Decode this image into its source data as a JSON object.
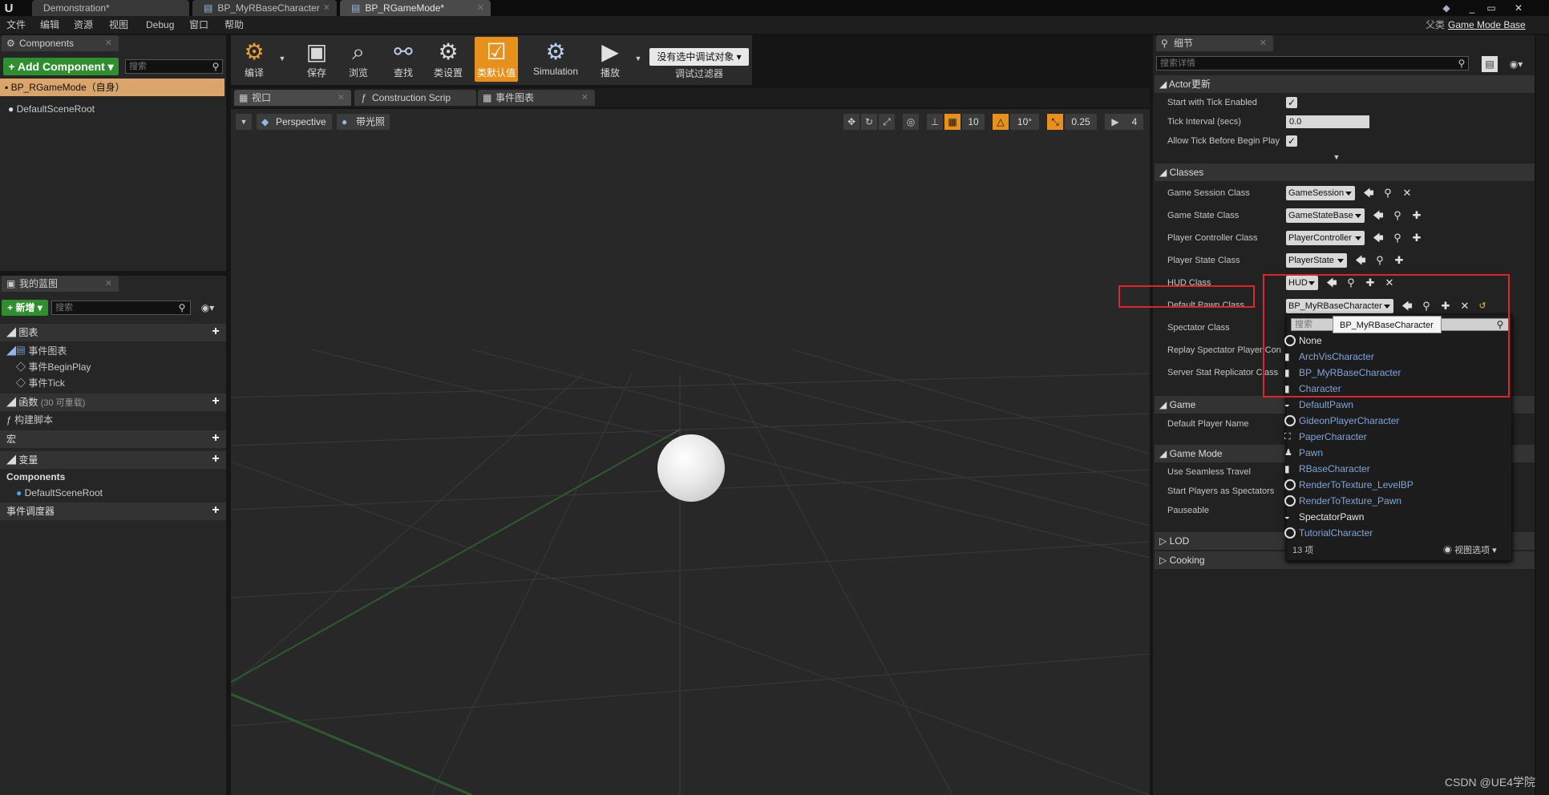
{
  "tabs": [
    {
      "label": "Demonstration*"
    },
    {
      "label": "BP_MyRBaseCharacter"
    },
    {
      "label": "BP_RGameMode*"
    }
  ],
  "menu": [
    "文件",
    "编辑",
    "资源",
    "视图",
    "Debug",
    "窗口",
    "帮助"
  ],
  "parent_class": {
    "prefix": "父类",
    "value": "Game Mode Base"
  },
  "components": {
    "tab": "Components",
    "add_button": "+ Add Component ▾",
    "search_placeholder": "搜索",
    "root": "BP_RGameMode（自身）",
    "child": "DefaultSceneRoot"
  },
  "myblueprint": {
    "tab": "我的蓝图",
    "new_button": "+ 新增 ▾",
    "search_placeholder": "搜索",
    "graphs_header": "图表",
    "event_graph": "事件图表",
    "events": [
      "事件BeginPlay",
      "事件Tick"
    ],
    "functions_header": "函数",
    "functions_count": "(30 可重载)",
    "construct": "构建脚本",
    "macros_header": "宏",
    "variables_header": "变量",
    "components_header": "Components",
    "comp_item": "DefaultSceneRoot",
    "dispatchers_header": "事件调度器"
  },
  "toolbar": [
    {
      "label": "编译",
      "icon": "compile-icon"
    },
    {
      "label": "保存",
      "icon": "save-icon"
    },
    {
      "label": "浏览",
      "icon": "browse-icon"
    },
    {
      "label": "查找",
      "icon": "find-icon"
    },
    {
      "label": "类设置",
      "icon": "class-settings-icon"
    },
    {
      "label": "类默认值",
      "icon": "class-defaults-icon"
    },
    {
      "label": "Simulation",
      "icon": "simulation-icon"
    },
    {
      "label": "播放",
      "icon": "play-icon"
    }
  ],
  "debug_filter": {
    "value": "没有选中调试对象 ▾",
    "label": "调试过滤器"
  },
  "editor_tabs": [
    {
      "label": "视口"
    },
    {
      "label": "Construction Scrip"
    },
    {
      "label": "事件图表"
    }
  ],
  "viewport": {
    "perspective": "Perspective",
    "lit": "带光照",
    "grid_snap": "10",
    "rot_snap": "10°",
    "scale_snap": "0.25",
    "cam_speed": "4"
  },
  "details": {
    "tab": "细节",
    "search_placeholder": "搜索详情",
    "actor_section": "Actor更新",
    "actor_rows": [
      {
        "label": "Start with Tick Enabled",
        "checked": true
      },
      {
        "label": "Tick Interval (secs)",
        "value": "0.0"
      },
      {
        "label": "Allow Tick Before Begin Play",
        "checked": true
      }
    ],
    "classes_section": "Classes",
    "class_rows": [
      {
        "label": "Game Session Class",
        "value": "GameSession"
      },
      {
        "label": "Game State Class",
        "value": "GameStateBase"
      },
      {
        "label": "Player Controller Class",
        "value": "PlayerController"
      },
      {
        "label": "Player State Class",
        "value": "PlayerState"
      },
      {
        "label": "HUD Class",
        "value": "HUD"
      },
      {
        "label": "Default Pawn Class",
        "value": "BP_MyRBaseCharacter"
      },
      {
        "label": "Spectator Class",
        "value": ""
      },
      {
        "label": "Replay Spectator Player Con",
        "value": ""
      },
      {
        "label": "Server Stat Replicator Class",
        "value": ""
      }
    ],
    "game_section": "Game",
    "game_rows": [
      {
        "label": "Default Player Name"
      }
    ],
    "gamemode_section": "Game Mode",
    "gamemode_rows": [
      {
        "label": "Use Seamless Travel"
      },
      {
        "label": "Start Players as Spectators"
      },
      {
        "label": "Pauseable"
      }
    ],
    "lod_section": "LOD",
    "cooking_section": "Cooking"
  },
  "picker": {
    "search_placeholder": "搜索",
    "tooltip": "BP_MyRBaseCharacter",
    "items": [
      {
        "label": "None",
        "icon": "ring",
        "white": true
      },
      {
        "label": "ArchVisCharacter",
        "icon": "character"
      },
      {
        "label": "BP_MyRBaseCharacter",
        "icon": "character"
      },
      {
        "label": "Character",
        "icon": "character"
      },
      {
        "label": "DefaultPawn",
        "icon": "pawn"
      },
      {
        "label": "GideonPlayerCharacter",
        "icon": "ring"
      },
      {
        "label": "PaperCharacter",
        "icon": "paper"
      },
      {
        "label": "Pawn",
        "icon": "character"
      },
      {
        "label": "RBaseCharacter",
        "icon": "character"
      },
      {
        "label": "RenderToTexture_LevelBP",
        "icon": "ring"
      },
      {
        "label": "RenderToTexture_Pawn",
        "icon": "ring"
      },
      {
        "label": "SpectatorPawn",
        "icon": "pawn",
        "white": true
      },
      {
        "label": "TutorialCharacter",
        "icon": "ring"
      }
    ],
    "count": "13 项",
    "view_options": "视图选项 ▾"
  },
  "watermark": "CSDN @UE4学院"
}
